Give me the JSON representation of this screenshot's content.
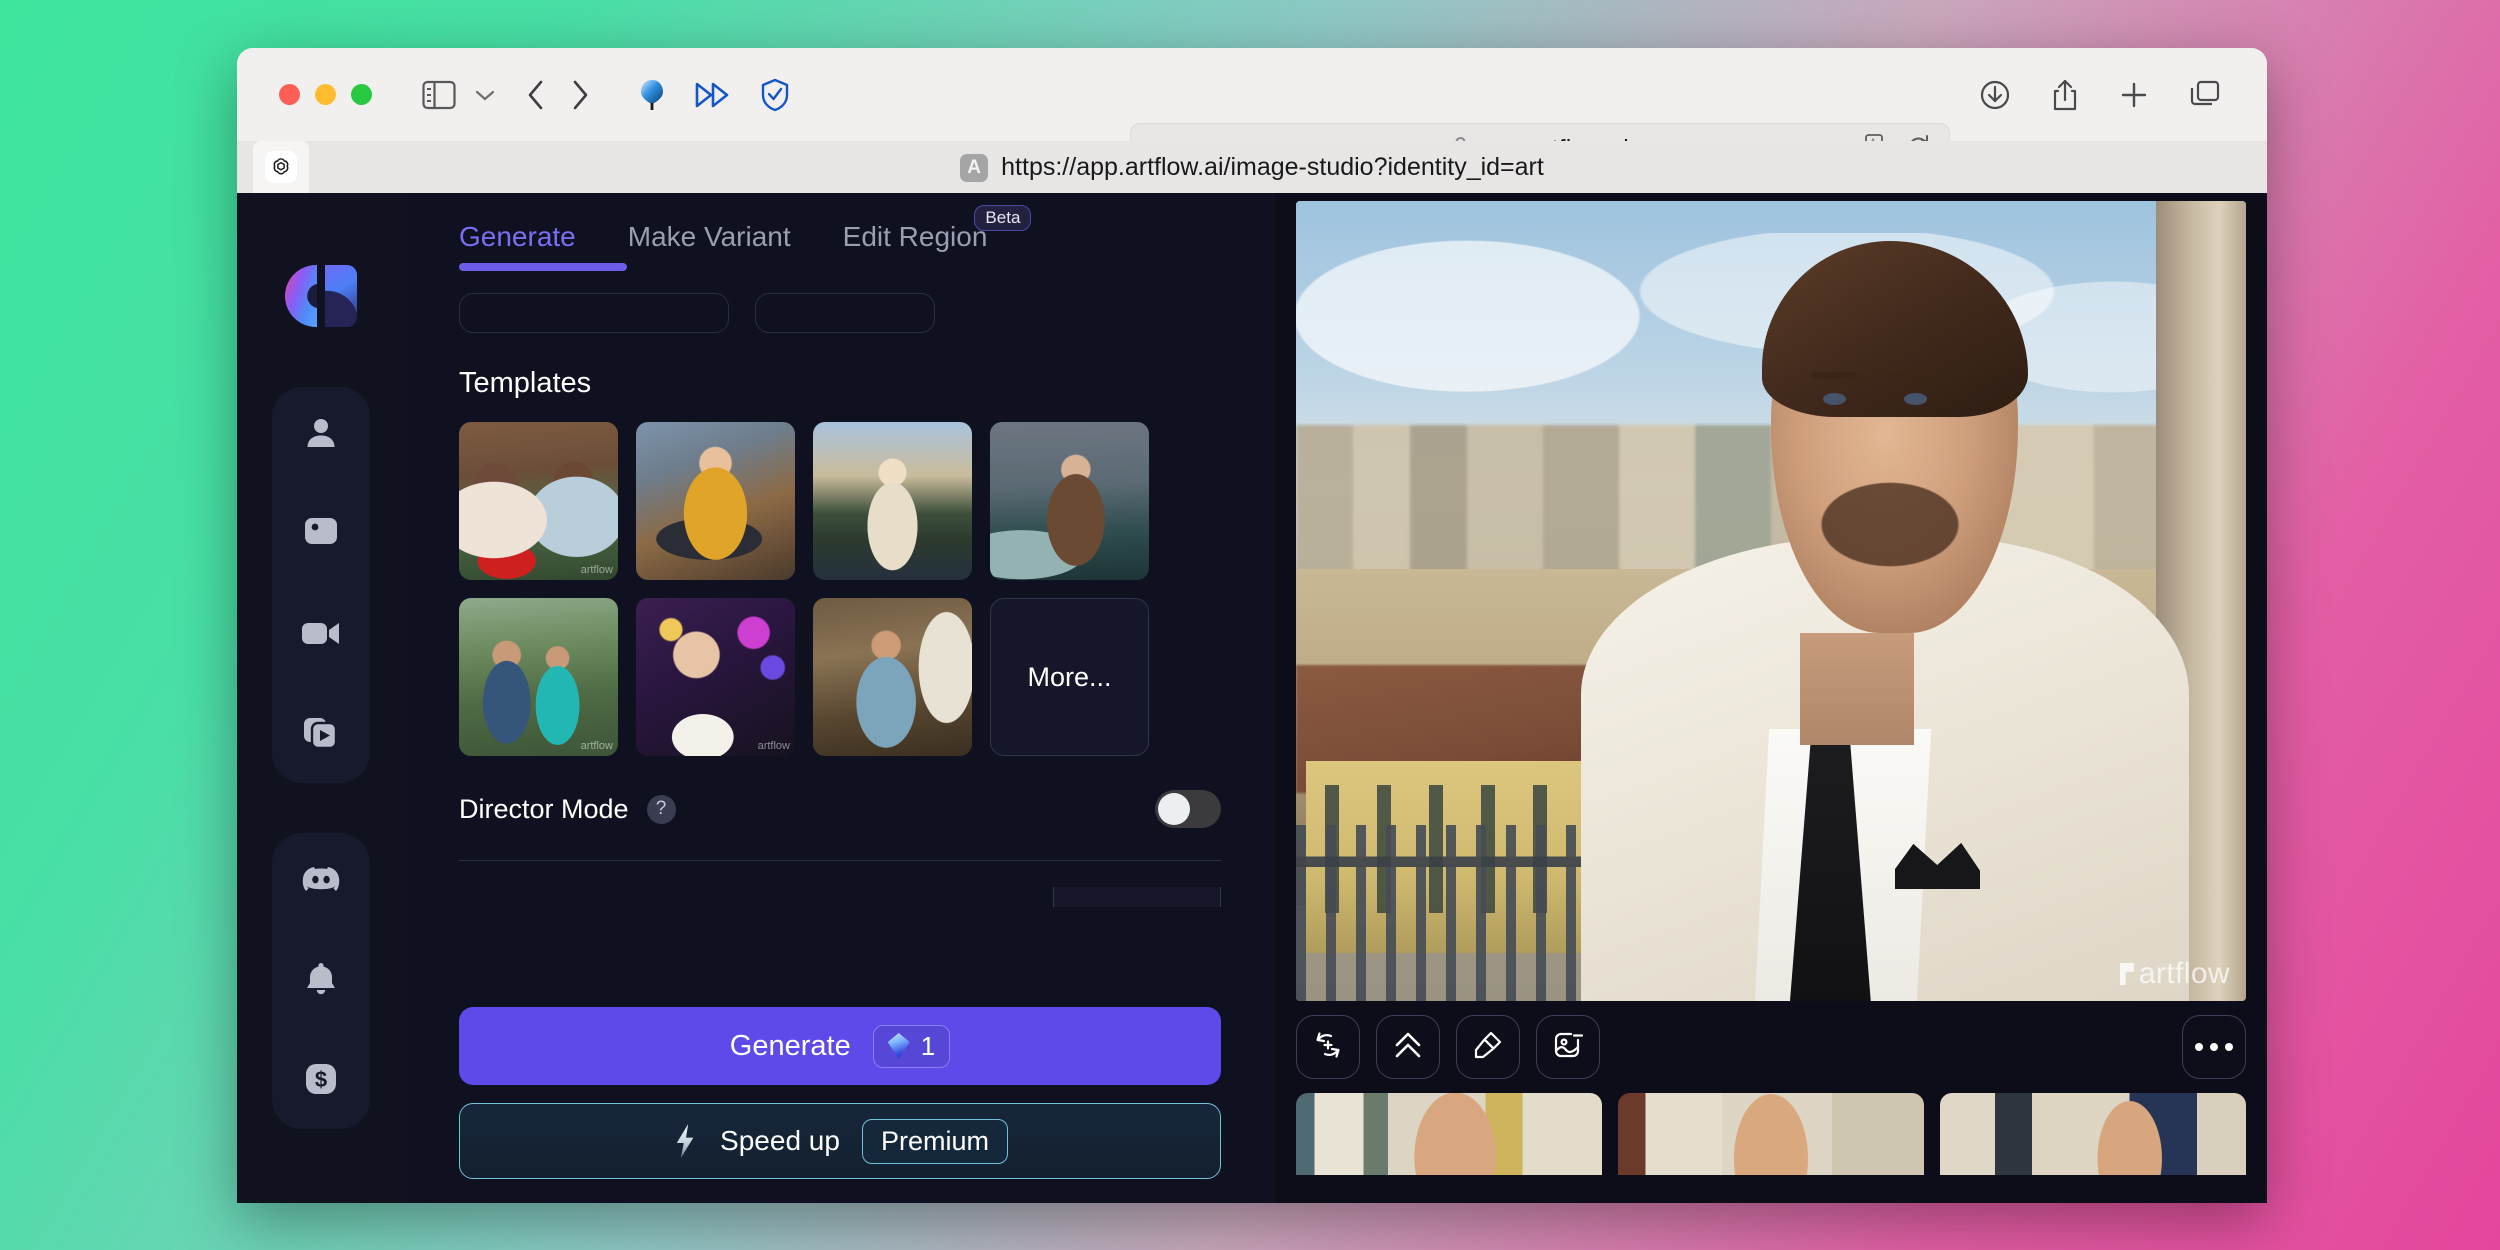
{
  "browser": {
    "address_value": "app.artflow.ai",
    "lock_icon": "lock-icon",
    "status_url": "https://app.artflow.ai/image-studio?identity_id=art",
    "status_badge": "A",
    "icons": {
      "sidebar": "sidebar-toggle-icon",
      "chevron": "chevron-down-icon",
      "back": "back-arrow-icon",
      "forward": "forward-arrow-icon",
      "ext_1": "balloon-extension-icon",
      "ext_2": "fast-forward-extension-icon",
      "ext_3": "shield-check-extension-icon",
      "translate": "translate-icon",
      "reload": "reload-icon",
      "download": "download-icon",
      "share": "share-icon",
      "new_tab": "plus-icon",
      "tab_overview": "tab-overview-icon",
      "tab_favicon": "openai-favicon"
    }
  },
  "rail": {
    "logo": "artflow-logo",
    "items": [
      {
        "name": "characters",
        "icon": "person-icon"
      },
      {
        "name": "images",
        "icon": "image-icon"
      },
      {
        "name": "video",
        "icon": "video-camera-icon"
      },
      {
        "name": "library",
        "icon": "media-stack-icon"
      }
    ],
    "lower_items": [
      {
        "name": "discord",
        "icon": "discord-icon"
      },
      {
        "name": "notifications",
        "icon": "bell-icon"
      },
      {
        "name": "billing",
        "icon": "dollar-icon"
      }
    ]
  },
  "panel": {
    "tabs": [
      {
        "label": "Generate",
        "active": true,
        "badge": null
      },
      {
        "label": "Make Variant",
        "active": false,
        "badge": null
      },
      {
        "label": "Edit Region",
        "active": false,
        "badge": "Beta"
      }
    ],
    "templates_title": "Templates",
    "templates": [
      {
        "name": "gift-couple",
        "watermark": "artflow"
      },
      {
        "name": "action-hero",
        "watermark": ""
      },
      {
        "name": "trench-coat-estate",
        "watermark": ""
      },
      {
        "name": "viking-sea",
        "watermark": ""
      },
      {
        "name": "hiking-couple",
        "watermark": "artflow"
      },
      {
        "name": "celebration-champagne",
        "watermark": "artflow"
      },
      {
        "name": "artisan-workshop",
        "watermark": ""
      }
    ],
    "more_label": "More...",
    "director_mode": {
      "label": "Director Mode",
      "help_icon": "question-mark-icon",
      "enabled": false
    },
    "generate": {
      "label": "Generate",
      "cost": "1",
      "cost_icon": "gem-icon"
    },
    "speed_up": {
      "label": "Speed up",
      "badge": "Premium",
      "icon": "lightning-bolt-icon"
    }
  },
  "canvas": {
    "hero": {
      "name": "generated-portrait",
      "watermark": "artflow"
    },
    "tools": [
      {
        "name": "make-variant",
        "icon": "refresh-plus-icon"
      },
      {
        "name": "upscale",
        "icon": "double-chevron-up-icon"
      },
      {
        "name": "retouch",
        "icon": "paint-brush-icon"
      },
      {
        "name": "remove-background",
        "icon": "image-minus-icon"
      }
    ],
    "more_tool": {
      "name": "more-options",
      "icon": "ellipsis-icon"
    },
    "thumbnails": [
      {
        "name": "variant-1"
      },
      {
        "name": "variant-2"
      },
      {
        "name": "variant-3"
      }
    ]
  },
  "colors": {
    "accent": "#6C5CE7",
    "generate_button": "#5D4AE8",
    "tab_active": "#7C6DF2",
    "premium_border": "#6FC2DA",
    "app_bg": "#0F1020",
    "rail_bg": "#11121F",
    "bg_gradient_start": "#3DE49C",
    "bg_gradient_end": "#E4469B"
  }
}
